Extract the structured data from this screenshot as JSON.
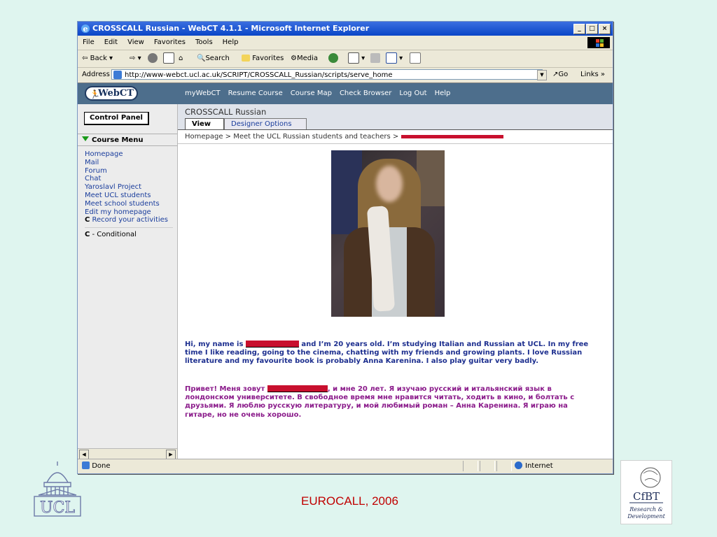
{
  "window": {
    "title": "CROSSCALL Russian - WebCT 4.1.1 - Microsoft Internet Explorer",
    "menu": [
      "File",
      "Edit",
      "View",
      "Favorites",
      "Tools",
      "Help"
    ],
    "toolbar": {
      "back": "Back",
      "search": "Search",
      "favorites": "Favorites",
      "media": "Media"
    },
    "address_label": "Address",
    "url": "http://www-webct.ucl.ac.uk/SCRIPT/CROSSCALL_Russian/scripts/serve_home",
    "go": "Go",
    "links": "Links"
  },
  "webct": {
    "logo": "WebCT",
    "nav": [
      "myWebCT",
      "Resume Course",
      "Course Map",
      "Check Browser",
      "Log Out",
      "Help"
    ],
    "control_panel": "Control Panel",
    "course_menu_title": "Course Menu",
    "course_menu": [
      "Homepage",
      "Mail",
      "Forum",
      "Chat",
      "Yaroslavl Project",
      "Meet UCL students",
      "Meet school students",
      "Edit my homepage"
    ],
    "record_prefix": "C",
    "record_label": "Record your activities",
    "conditional_prefix": "C",
    "conditional_label": " - Conditional",
    "course_title": "CROSSCALL Russian",
    "tabs": {
      "view": "View",
      "designer": "Designer Options"
    },
    "breadcrumb": "Homepage > Meet the UCL Russian students and teachers >"
  },
  "content": {
    "en_before": "Hi, my name is ",
    "en_after": " and I’m 20 years old. I’m studying Italian and Russian at UCL. In my free time I like reading, going to the cinema, chatting with my friends and growing plants. I love Russian literature and my favourite book is probably Anna Karenina. I also play guitar very badly.",
    "ru_before": " Привет! Меня зовут ",
    "ru_after": ", и мне 20 лет. Я изучаю русский и итальянский язык в лондонском университете. В свободное время мне нравится читать, ходить в кино, и болтать с друзьями. Я люблю русскую литературу, и мой любимый роман – Анна Каренина. Я играю на гитаре, но не очень хорошо."
  },
  "status": {
    "text": "Done",
    "zone": "Internet"
  },
  "slide": {
    "footer": "EUROCALL, 2006",
    "ucl_logo": "UCL",
    "cfbt_logo": "CfBT",
    "cfbt_sub1": "Research &",
    "cfbt_sub2": "Development"
  },
  "colors": {
    "webct_bar": "#4d6e8c",
    "link_blue": "#1a3d9c",
    "english_text": "#1d2f8f",
    "russian_text": "#8a1a8a",
    "redaction": "#c8102e",
    "footer_red": "#c00000"
  }
}
